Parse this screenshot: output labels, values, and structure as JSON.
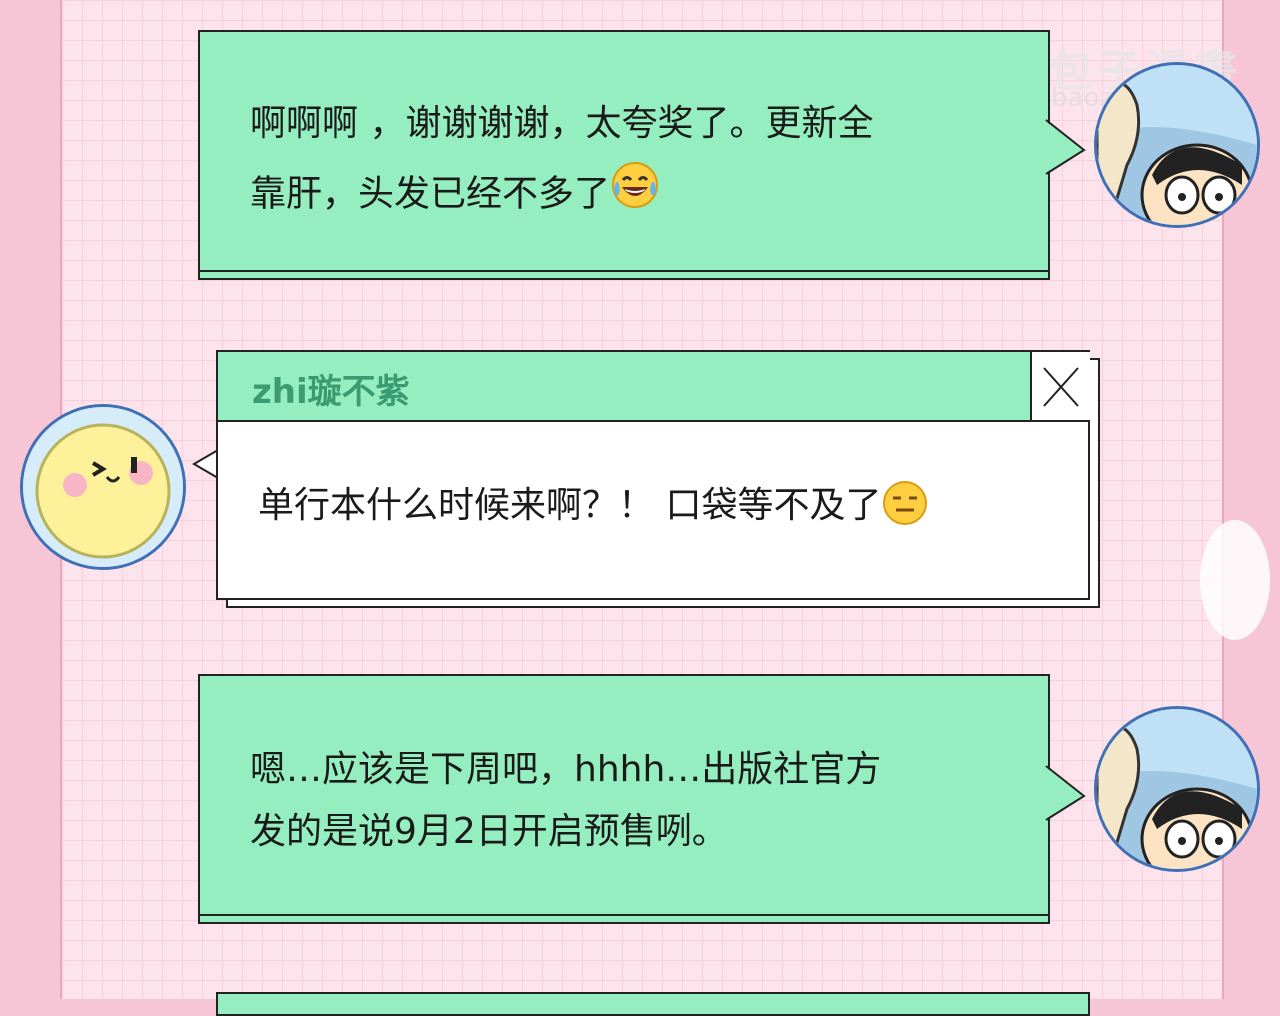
{
  "watermark": {
    "name": "包子漫畫",
    "url": "baozimh.com",
    "logo_icon": "bun-logo-icon"
  },
  "messages": [
    {
      "side": "right",
      "lines": [
        "啊啊啊 ，谢谢谢谢，太夸奖了。更新全",
        "靠肝，头发已经不多了"
      ],
      "emoji": "laughing-crying-emoji"
    },
    {
      "side": "left",
      "username": "zhi璇不紫",
      "text": "单行本什么时候来啊？！ 口袋等不及了",
      "emoji": "expressionless-emoji"
    },
    {
      "side": "right",
      "lines": [
        "嗯…应该是下周吧，hhhh…出版社官方",
        "发的是说9月2日开启预售咧。"
      ]
    }
  ],
  "colors": {
    "bubble_green": "#95eebf",
    "username_green": "#3a9a72",
    "page_pink": "#fde4ec",
    "avatar_border": "#3f6fb5"
  }
}
